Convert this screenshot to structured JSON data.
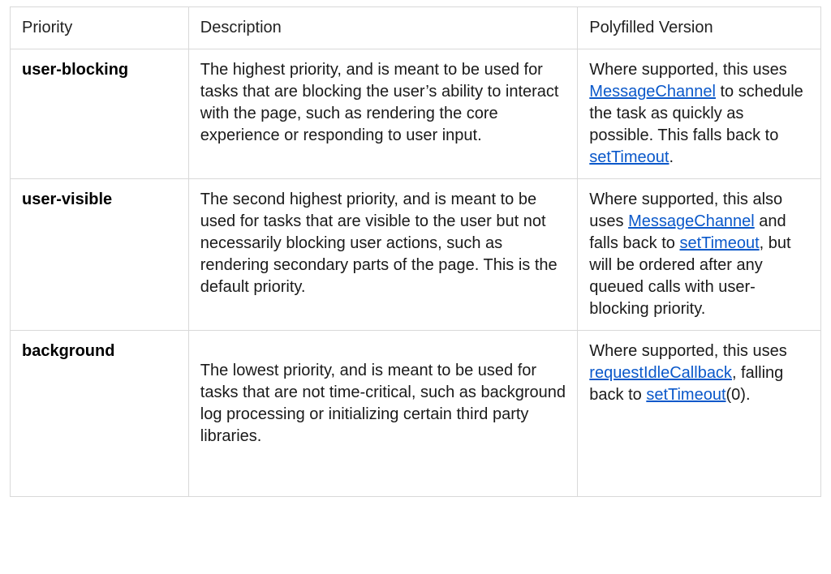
{
  "headers": {
    "priority": "Priority",
    "description": "Description",
    "polyfilled": "Polyfilled Version"
  },
  "rows": {
    "user_blocking": {
      "name": "user-blocking",
      "description": "The highest priority, and is meant to be used for tasks that are blocking the user’s ability to interact with the page, such as rendering the core experience or responding to user input.",
      "poly": {
        "p0": "Where supported, this uses ",
        "link0": "MessageChannel",
        "p1": " to schedule the task as quickly as possible. This falls back to ",
        "link1": "setTimeout",
        "p2": "."
      }
    },
    "user_visible": {
      "name": "user-visible",
      "description": "The second highest priority, and is meant to be used for tasks that are visible to the user but not necessarily blocking user actions, such as rendering secondary parts of the page. This is the default priority.",
      "poly": {
        "p0": "Where supported, this also uses ",
        "link0": "MessageChannel",
        "p1": " and falls back to ",
        "link1": "setTimeout",
        "p2": ", but will be ordered after any queued calls with user-blocking priority."
      }
    },
    "background": {
      "name": "background",
      "description": "The lowest priority, and is meant to be used for tasks that are not time-critical, such as background log processing or initializing certain third party libraries.",
      "poly": {
        "p0": "Where supported, this uses ",
        "link0": "requestIdleCallback",
        "p1": ", falling back to ",
        "link1": "setTimeout",
        "p2": "(0)."
      }
    }
  }
}
